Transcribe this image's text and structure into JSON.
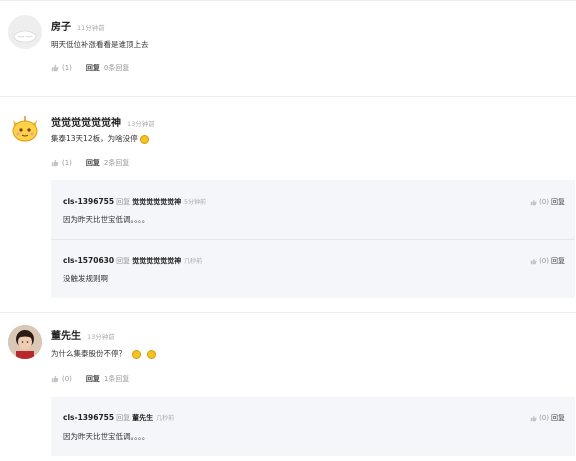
{
  "comments": [
    {
      "name": "房子",
      "time": "11分钟前",
      "text": "明天低位补涨看看是谁顶上去",
      "likes": "(1)",
      "reply_label": "回复",
      "reply_count": "0条回复"
    },
    {
      "name": "觉觉觉觉觉觉神",
      "time": "13分钟前",
      "text": "集泰13天12板，为啥没停",
      "likes": "(1)",
      "reply_label": "回复",
      "reply_count": "2条回复",
      "replies": [
        {
          "user": "cls-1396755",
          "verb": "回复",
          "to": "觉觉觉觉觉觉神",
          "time": "5分钟前",
          "text": "因为昨天比世宝低调。。。。",
          "likes": "(0)",
          "reply_label": "回复"
        },
        {
          "user": "cls-1570630",
          "verb": "回复",
          "to": "觉觉觉觉觉觉神",
          "time": "几秒前",
          "text": "没触发规则啊",
          "likes": "(0)",
          "reply_label": "回复"
        }
      ]
    },
    {
      "name": "董先生",
      "time": "13分钟前",
      "text": "为什么集泰股份不停？",
      "likes": "(0)",
      "reply_label": "回复",
      "reply_count": "1条回复",
      "replies": [
        {
          "user": "cls-1396755",
          "verb": "回复",
          "to": "董先生",
          "time": "几秒前",
          "text": "因为昨天比世宝低调。。。。",
          "likes": "(0)",
          "reply_label": "回复"
        }
      ]
    }
  ],
  "colors": {
    "reply_bg": "#f5f6f9",
    "divider": "#ececec",
    "muted": "#999999",
    "emoji": "#f6c224"
  },
  "icons": {
    "like": "thumbs-up-icon",
    "emoji": "smiley-emoji-icon"
  }
}
